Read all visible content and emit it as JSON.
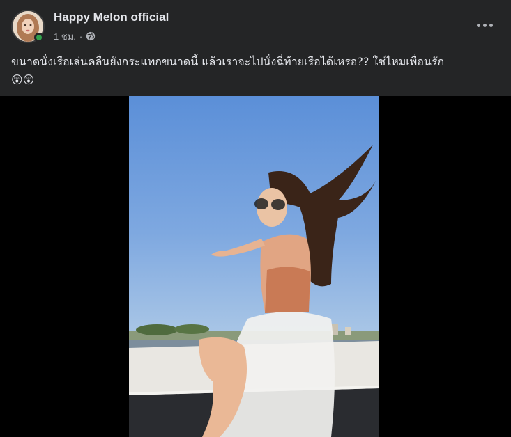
{
  "post": {
    "author": "Happy Melon official",
    "time": "1 ชม.",
    "separator": "·",
    "audience_icon": "globe-icon",
    "text_line1": "ขนาดนั่งเรือเล่นคลื่นยังกระแทกขนาดนี้  แล้วเราจะไปนั่งฉี่ท้ายเรือได้เหรอ??   ใช่ไหมเพื่อนรัก",
    "emoji": "😲😲"
  },
  "colors": {
    "background": "#242526",
    "text_primary": "#e4e6eb",
    "text_secondary": "#b0b3b8",
    "online": "#31a24c",
    "video_bg": "#000000"
  }
}
